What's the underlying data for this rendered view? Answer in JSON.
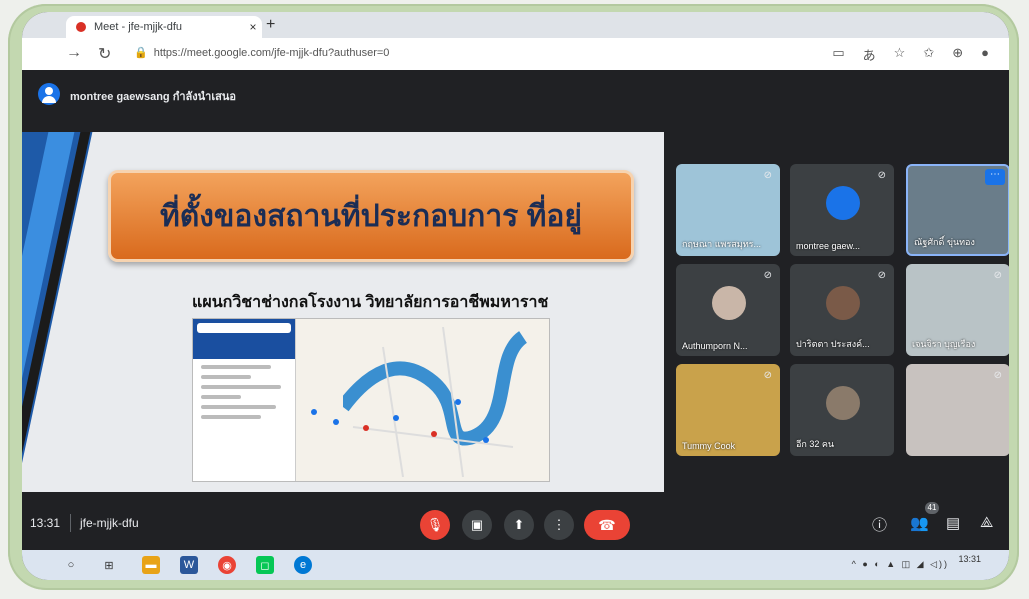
{
  "browser": {
    "tab_title": "Meet - jfe-mjjk-dfu",
    "tab_close": "×",
    "new_tab": "+",
    "url": "https://meet.google.com/jfe-mjjk-dfu?authuser=0"
  },
  "header": {
    "presenter_text": "montree gaewsang กำลังนำเสนอ"
  },
  "slide": {
    "title": "ที่ตั้งของสถานที่ประกอบการ ที่อยู่",
    "subtitle": "แผนกวิชาช่างกลโรงงาน วิทยาลัยการอาชีพมหาราช"
  },
  "participants": [
    {
      "name": "กฤษณา แพรสมุทร...",
      "color": "#9ec4d8"
    },
    {
      "name": "montree gaew...",
      "color": "#3c4043"
    },
    {
      "name": "ณัฐศักดิ์ ขุ่นทอง",
      "color": "#6a7d8a"
    },
    {
      "name": "Authumporn N...",
      "color": "#3c4043"
    },
    {
      "name": "ปาริตตา ประสงค์...",
      "color": "#3c4043"
    },
    {
      "name": "เจนจิรา บุญเรือง",
      "color": "#b9c3c6"
    },
    {
      "name": "Tummy Cook",
      "color": "#c9a24b"
    },
    {
      "name": "อีก 32 คน",
      "color": "#3c4043"
    },
    {
      "name": "",
      "color": "#c8c2bf"
    }
  ],
  "toolbar": {
    "time": "13:31",
    "meeting_code": "jfe-mjjk-dfu",
    "participant_count": "41"
  },
  "taskbar": {
    "clock": "13:31"
  }
}
